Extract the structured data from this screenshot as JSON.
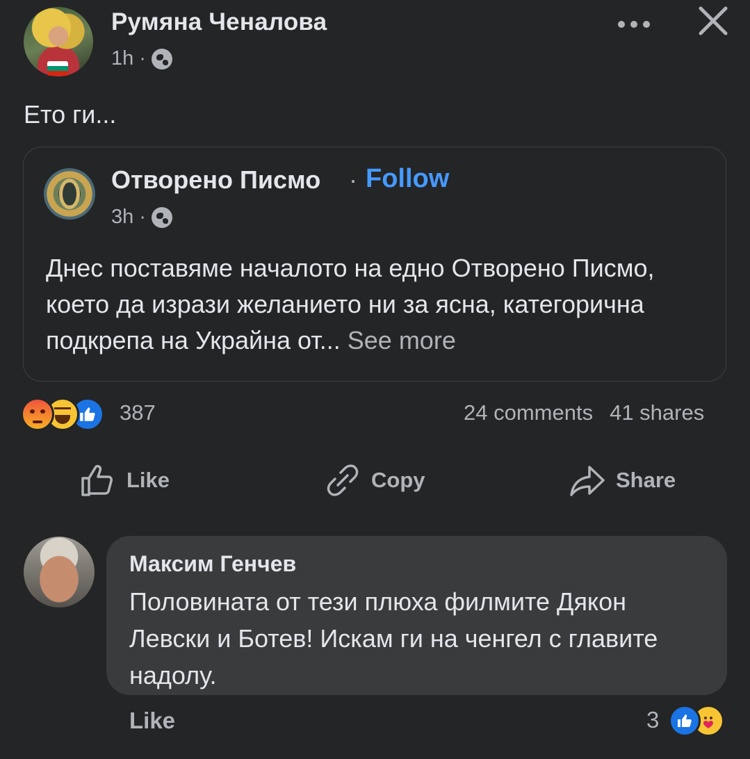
{
  "post": {
    "author": "Румяна Ченалова",
    "time": "1h",
    "separator": "·",
    "text": "Ето ги..."
  },
  "shared": {
    "page_name": "Отворено Писмо",
    "separator": "·",
    "follow_label": "Follow",
    "time": "3h",
    "text": "Днес поставяме началото на едно Отворено Писмо, което да изрази желанието ни за ясна, категорична подкрепа на Украйна от...",
    "see_more": "See more"
  },
  "stats": {
    "reaction_count": "387",
    "comments": "24 comments",
    "shares": "41 shares"
  },
  "actions": {
    "like": "Like",
    "copy": "Copy",
    "share": "Share"
  },
  "comment": {
    "author": "Максим Генчев",
    "text": "Половината от тези плюха филмите Дякон Левски и Ботев! Искам ги на ченгел с главите надолу.",
    "like_label": "Like",
    "reaction_count": "3"
  },
  "colors": {
    "background": "#242526",
    "bubble": "#3a3b3c",
    "link_blue": "#4599ff",
    "secondary_text": "#b0b3b8"
  },
  "icons": [
    "more-icon",
    "close-icon",
    "globe-icon",
    "like-icon",
    "copy-link-icon",
    "share-icon",
    "angry-reaction-icon",
    "haha-reaction-icon",
    "like-reaction-icon",
    "care-reaction-icon"
  ]
}
